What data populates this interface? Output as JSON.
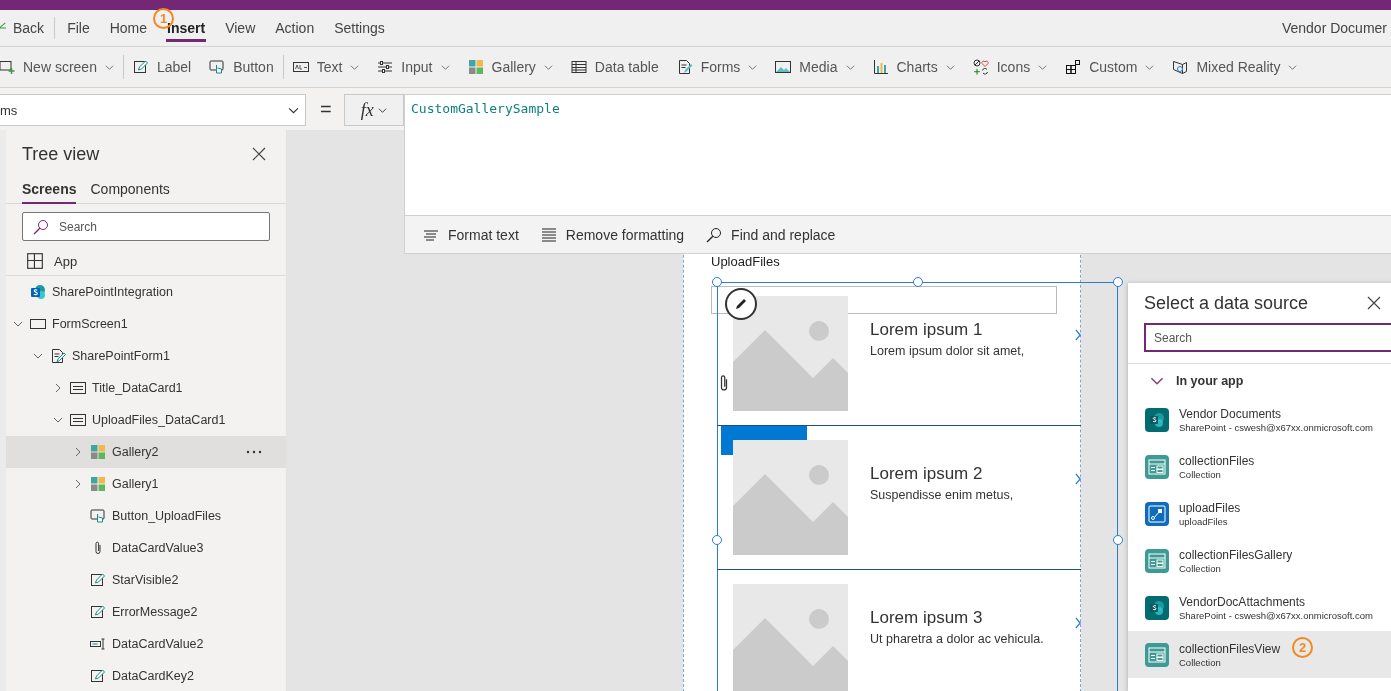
{
  "menu": {
    "back": "Back",
    "tabs": [
      {
        "label": "File",
        "selected": false
      },
      {
        "label": "Home",
        "selected": false
      },
      {
        "label": "Insert",
        "selected": true,
        "callout": "1"
      },
      {
        "label": "View",
        "selected": false
      },
      {
        "label": "Action",
        "selected": false
      },
      {
        "label": "Settings",
        "selected": false
      }
    ],
    "app_title": "Vendor Documer"
  },
  "ribbon": {
    "groups": [
      [
        {
          "label": "New screen",
          "kind": "newscreen",
          "dropdown": true
        }
      ],
      [
        {
          "label": "Label",
          "kind": "label",
          "dropdown": false
        },
        {
          "label": "Button",
          "kind": "button",
          "dropdown": false
        }
      ],
      [
        {
          "label": "Text",
          "kind": "text",
          "dropdown": true
        },
        {
          "label": "Input",
          "kind": "input",
          "dropdown": true
        },
        {
          "label": "Gallery",
          "kind": "gallery",
          "dropdown": true
        },
        {
          "label": "Data table",
          "kind": "datatable",
          "dropdown": false
        },
        {
          "label": "Forms",
          "kind": "forms",
          "dropdown": true
        },
        {
          "label": "Media",
          "kind": "media",
          "dropdown": true
        },
        {
          "label": "Charts",
          "kind": "charts",
          "dropdown": true
        },
        {
          "label": "Icons",
          "kind": "icons",
          "dropdown": true
        },
        {
          "label": "Custom",
          "kind": "custom",
          "dropdown": true
        },
        {
          "label": "Mixed Reality",
          "kind": "mixedreality",
          "dropdown": true
        }
      ]
    ]
  },
  "formula": {
    "property": "ms",
    "equals": "=",
    "fx": "fx",
    "value": "CustomGallerySample",
    "tools": [
      {
        "label": "Format text",
        "kind": "format"
      },
      {
        "label": "Remove formatting",
        "kind": "remove"
      },
      {
        "label": "Find and replace",
        "kind": "find"
      }
    ]
  },
  "tree_view": {
    "title": "Tree view",
    "tabs": [
      {
        "label": "Screens",
        "selected": true
      },
      {
        "label": "Components",
        "selected": false
      }
    ],
    "search": {
      "placeholder": "Search"
    },
    "app": "App",
    "nodes": [
      {
        "label": "SharePointIntegration",
        "kind": "sharepoint",
        "selected": false
      },
      {
        "label": "FormScreen1",
        "kind": "screen",
        "expanded": true,
        "selected": false,
        "children": [
          {
            "label": "SharePointForm1",
            "kind": "form",
            "expanded": true,
            "selected": false,
            "children": [
              {
                "label": "Title_DataCard1",
                "kind": "card",
                "expanded": false,
                "selected": false
              },
              {
                "label": "UploadFiles_DataCard1",
                "kind": "card",
                "expanded": true,
                "selected": false,
                "children": [
                  {
                    "label": "Gallery2",
                    "kind": "gallery",
                    "expanded": false,
                    "selected": true
                  },
                  {
                    "label": "Gallery1",
                    "kind": "gallery",
                    "expanded": false,
                    "selected": false
                  },
                  {
                    "label": "Button_UploadFiles",
                    "kind": "button",
                    "selected": false
                  },
                  {
                    "label": "DataCardValue3",
                    "kind": "attachment",
                    "selected": false
                  },
                  {
                    "label": "StarVisible2",
                    "kind": "label",
                    "selected": false
                  },
                  {
                    "label": "ErrorMessage2",
                    "kind": "label",
                    "selected": false
                  },
                  {
                    "label": "DataCardValue2",
                    "kind": "textinput",
                    "selected": false
                  },
                  {
                    "label": "DataCardKey2",
                    "kind": "label",
                    "selected": false
                  }
                ]
              }
            ]
          }
        ]
      }
    ]
  },
  "canvas": {
    "card_label": "UploadFiles",
    "gallery": [
      {
        "title": "Lorem ipsum 1",
        "subtitle": "Lorem ipsum dolor sit amet,"
      },
      {
        "title": "Lorem ipsum 2",
        "subtitle": "Suspendisse enim metus,"
      },
      {
        "title": "Lorem ipsum 3",
        "subtitle": "Ut pharetra a dolor ac vehicula."
      }
    ]
  },
  "data_source_panel": {
    "title": "Select a data source",
    "search": {
      "placeholder": "Search"
    },
    "section": {
      "label": "In your app",
      "expanded": true
    },
    "sources": [
      {
        "name": "Vendor Documents",
        "detail": "SharePoint - cswesh@x67xx.onmicrosoft.com",
        "kind": "sharepoint",
        "selected": false
      },
      {
        "name": "collectionFiles",
        "detail": "Collection",
        "kind": "collection",
        "selected": false
      },
      {
        "name": "uploadFiles",
        "detail": "uploadFiles",
        "kind": "flow",
        "selected": false
      },
      {
        "name": "collectionFilesGallery",
        "detail": "Collection",
        "kind": "collection",
        "selected": false
      },
      {
        "name": "VendorDocAttachments",
        "detail": "SharePoint - cswesh@x67xx.onmicrosoft.com",
        "kind": "sharepoint",
        "selected": false
      },
      {
        "name": "collectionFilesView",
        "detail": "Collection",
        "kind": "collection",
        "selected": true,
        "callout": "2"
      }
    ]
  }
}
